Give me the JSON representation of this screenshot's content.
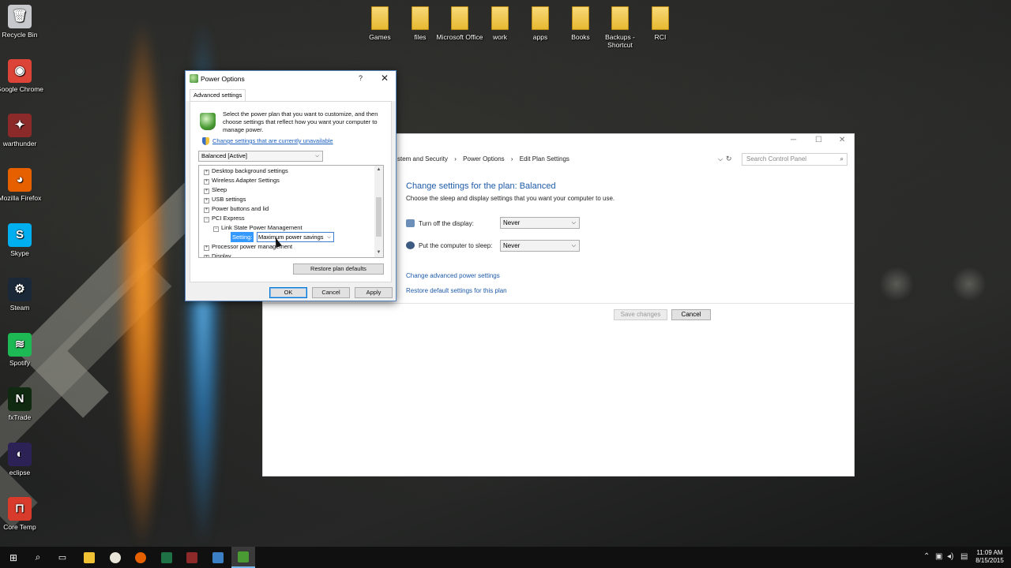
{
  "desktop": {
    "left_icons": [
      {
        "label": "Recycle Bin",
        "icon": "recycle-bin-icon",
        "color": "#c7c9cc",
        "glyph": "🗑"
      },
      {
        "label": "Google Chrome",
        "icon": "chrome-icon",
        "color": "#db4437",
        "glyph": "◉"
      },
      {
        "label": "warthunder",
        "icon": "warthunder-icon",
        "color": "#8c2a2a",
        "glyph": "✦"
      },
      {
        "label": "Mozilla Firefox",
        "icon": "firefox-icon",
        "color": "#e66000",
        "glyph": "◕"
      },
      {
        "label": "Skype",
        "icon": "skype-icon",
        "color": "#00aff0",
        "glyph": "S"
      },
      {
        "label": "Steam",
        "icon": "steam-icon",
        "color": "#1b2838",
        "glyph": "⚙"
      },
      {
        "label": "Spotify",
        "icon": "spotify-icon",
        "color": "#1db954",
        "glyph": "≋"
      },
      {
        "label": "fxTrade",
        "icon": "fxtrade-icon",
        "color": "#0f2a10",
        "glyph": "N"
      },
      {
        "label": "eclipse",
        "icon": "eclipse-icon",
        "color": "#2c2255",
        "glyph": "◐"
      },
      {
        "label": "Core Temp",
        "icon": "core-temp-icon",
        "color": "#d83b2b",
        "glyph": "⊓"
      }
    ],
    "top_icons": [
      {
        "label": "Games",
        "icon": "folder-icon"
      },
      {
        "label": "files",
        "icon": "folder-icon"
      },
      {
        "label": "Microsoft Office",
        "icon": "folder-icon"
      },
      {
        "label": "work",
        "icon": "folder-icon"
      },
      {
        "label": "apps",
        "icon": "folder-icon"
      },
      {
        "label": "Books",
        "icon": "folder-icon"
      },
      {
        "label": "Backups - Shortcut",
        "icon": "folder-shortcut-icon"
      },
      {
        "label": "RCI",
        "icon": "folder-icon"
      }
    ]
  },
  "control_panel": {
    "breadcrumb": [
      "stem and Security",
      "›",
      "Power Options",
      "›",
      "Edit Plan Settings"
    ],
    "search_placeholder": "Search Control Panel",
    "heading": "Change settings for the plan: Balanced",
    "subheading": "Choose the sleep and display settings that you want your computer to use.",
    "display_label": "Turn off the display:",
    "display_value": "Never",
    "sleep_label": "Put the computer to sleep:",
    "sleep_value": "Never",
    "link_advanced": "Change advanced power settings",
    "link_restore": "Restore default settings for this plan",
    "save_label": "Save changes",
    "cancel_label": "Cancel"
  },
  "dialog": {
    "title": "Power Options",
    "help": "?",
    "close": "✕",
    "tab": "Advanced settings",
    "intro": "Select the power plan that you want to customize, and then choose settings that reflect how you want your computer to manage power.",
    "change_link": "Change settings that are currently unavailable",
    "plan_value": "Balanced [Active]",
    "tree": [
      {
        "label": "Desktop background settings",
        "exp": "+",
        "level": 0
      },
      {
        "label": "Wireless Adapter Settings",
        "exp": "+",
        "level": 0
      },
      {
        "label": "Sleep",
        "exp": "+",
        "level": 0
      },
      {
        "label": "USB settings",
        "exp": "+",
        "level": 0
      },
      {
        "label": "Power buttons and lid",
        "exp": "+",
        "level": 0
      },
      {
        "label": "PCI Express",
        "exp": "−",
        "level": 0
      },
      {
        "label": "Link State Power Management",
        "exp": "−",
        "level": 1
      },
      {
        "label": "",
        "exp": "",
        "level": 2
      },
      {
        "label": "Processor power management",
        "exp": "+",
        "level": 0
      },
      {
        "label": "Display",
        "exp": "+",
        "level": 0
      }
    ],
    "setting_label": "Setting:",
    "setting_value": "Maximum power savings",
    "restore_label": "Restore plan defaults",
    "ok_label": "OK",
    "cancel_label": "Cancel",
    "apply_label": "Apply"
  },
  "taskbar": {
    "clock_time": "11:09 AM",
    "clock_date": "8/15/2015"
  }
}
